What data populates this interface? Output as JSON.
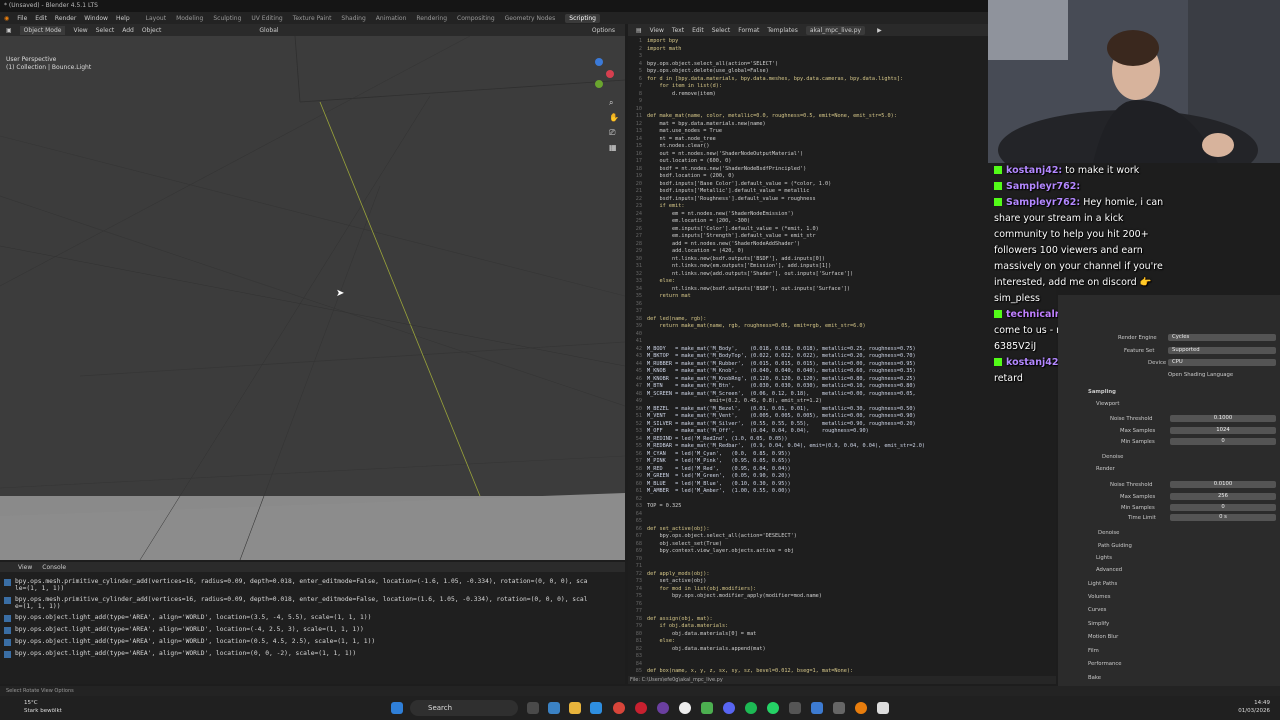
{
  "window": {
    "title": "* (Unsaved) - Blender 4.5.1 LTS"
  },
  "menu": {
    "items": [
      "File",
      "Edit",
      "Render",
      "Window",
      "Help"
    ],
    "workspaces": [
      "Layout",
      "Modeling",
      "Sculpting",
      "UV Editing",
      "Texture Paint",
      "Shading",
      "Animation",
      "Rendering",
      "Compositing",
      "Geometry Nodes",
      "Scripting"
    ],
    "active_workspace": "Scripting"
  },
  "viewport": {
    "header": [
      "Object Mode",
      "View",
      "Select",
      "Add",
      "Object"
    ],
    "transform": "Global",
    "options_label": "Options",
    "label_perspective": "User Perspective",
    "label_collection": "(1) Collection | Bounce.Light"
  },
  "console": {
    "header": [
      "View",
      "Console"
    ],
    "lines": [
      "bpy.ops.mesh.primitive_cylinder_add(vertices=16, radius=0.09, depth=0.018, enter_editmode=False, location=(-1.6, 1.05, -0.334), rotation=(0, 0, 0), sca\nle=(1, 1, 1))",
      "bpy.ops.mesh.primitive_cylinder_add(vertices=16, radius=0.09, depth=0.018, enter_editmode=False, location=(1.6, 1.05, -0.334), rotation=(0, 0, 0), scal\ne=(1, 1, 1))",
      "bpy.ops.object.light_add(type='AREA', align='WORLD', location=(3.5, -4, 5.5), scale=(1, 1, 1))",
      "bpy.ops.object.light_add(type='AREA', align='WORLD', location=(-4, 2.5, 3), scale=(1, 1, 1))",
      "bpy.ops.object.light_add(type='AREA', align='WORLD', location=(0.5, 4.5, 2.5), scale=(1, 1, 1))",
      "bpy.ops.object.light_add(type='AREA', align='WORLD', location=(0, 0, -2), scale=(1, 1, 1))"
    ]
  },
  "status_bar": {
    "text": "Select   Rotate View   Options"
  },
  "text_editor": {
    "header": [
      "View",
      "Text",
      "Edit",
      "Select",
      "Format",
      "Templates"
    ],
    "filename": "akal_mpc_live.py",
    "footer": "File: C:\\Users\\efe0g\\akal_mpc_live.py",
    "lines": [
      {
        "n": "1",
        "t": "import bpy"
      },
      {
        "n": "2",
        "t": "import math"
      },
      {
        "n": "3",
        "t": ""
      },
      {
        "n": "4",
        "t": "bpy.ops.object.select_all(action='SELECT')"
      },
      {
        "n": "5",
        "t": "bpy.ops.object.delete(use_global=False)"
      },
      {
        "n": "6",
        "t": "for d in [bpy.data.materials, bpy.data.meshes, bpy.data.cameras, bpy.data.lights]:"
      },
      {
        "n": "7",
        "t": "    for item in list(d):"
      },
      {
        "n": "8",
        "t": "        d.remove(item)"
      },
      {
        "n": "9",
        "t": ""
      },
      {
        "n": "10",
        "t": ""
      },
      {
        "n": "11",
        "t": "def make_mat(name, color, metallic=0.0, roughness=0.5, emit=None, emit_str=5.0):"
      },
      {
        "n": "12",
        "t": "    mat = bpy.data.materials.new(name)"
      },
      {
        "n": "13",
        "t": "    mat.use_nodes = True"
      },
      {
        "n": "14",
        "t": "    nt = mat.node_tree"
      },
      {
        "n": "15",
        "t": "    nt.nodes.clear()"
      },
      {
        "n": "16",
        "t": "    out = nt.nodes.new('ShaderNodeOutputMaterial')"
      },
      {
        "n": "17",
        "t": "    out.location = (600, 0)"
      },
      {
        "n": "18",
        "t": "    bsdf = nt.nodes.new('ShaderNodeBsdfPrincipled')"
      },
      {
        "n": "19",
        "t": "    bsdf.location = (200, 0)"
      },
      {
        "n": "20",
        "t": "    bsdf.inputs['Base Color'].default_value = (*color, 1.0)"
      },
      {
        "n": "21",
        "t": "    bsdf.inputs['Metallic'].default_value = metallic"
      },
      {
        "n": "22",
        "t": "    bsdf.inputs['Roughness'].default_value = roughness"
      },
      {
        "n": "23",
        "t": "    if emit:"
      },
      {
        "n": "24",
        "t": "        em = nt.nodes.new('ShaderNodeEmission')"
      },
      {
        "n": "25",
        "t": "        em.location = (200, -300)"
      },
      {
        "n": "26",
        "t": "        em.inputs['Color'].default_value = (*emit, 1.0)"
      },
      {
        "n": "27",
        "t": "        em.inputs['Strength'].default_value = emit_str"
      },
      {
        "n": "28",
        "t": "        add = nt.nodes.new('ShaderNodeAddShader')"
      },
      {
        "n": "29",
        "t": "        add.location = (420, 0)"
      },
      {
        "n": "30",
        "t": "        nt.links.new(bsdf.outputs['BSDF'], add.inputs[0])"
      },
      {
        "n": "31",
        "t": "        nt.links.new(em.outputs['Emission'], add.inputs[1])"
      },
      {
        "n": "32",
        "t": "        nt.links.new(add.outputs['Shader'], out.inputs['Surface'])"
      },
      {
        "n": "33",
        "t": "    else:"
      },
      {
        "n": "34",
        "t": "        nt.links.new(bsdf.outputs['BSDF'], out.inputs['Surface'])"
      },
      {
        "n": "35",
        "t": "    return mat"
      },
      {
        "n": "36",
        "t": ""
      },
      {
        "n": "37",
        "t": ""
      },
      {
        "n": "38",
        "t": "def led(name, rgb):"
      },
      {
        "n": "39",
        "t": "    return make_mat(name, rgb, roughness=0.05, emit=rgb, emit_str=6.0)"
      },
      {
        "n": "40",
        "t": ""
      },
      {
        "n": "41",
        "t": ""
      },
      {
        "n": "42",
        "t": "M_BODY   = make_mat('M_Body',    (0.018, 0.018, 0.018), metallic=0.25, roughness=0.75)"
      },
      {
        "n": "43",
        "t": "M_BKTOP  = make_mat('M_BodyTop', (0.022, 0.022, 0.022), metallic=0.20, roughness=0.70)"
      },
      {
        "n": "44",
        "t": "M_RUBBER = make_mat('M_Rubber',  (0.015, 0.015, 0.015), metallic=0.00, roughness=0.95)"
      },
      {
        "n": "45",
        "t": "M_KNOB   = make_mat('M_Knob',    (0.040, 0.040, 0.040), metallic=0.60, roughness=0.35)"
      },
      {
        "n": "46",
        "t": "M_KNOBR  = make_mat('M_KnobRng', (0.120, 0.120, 0.120), metallic=0.80, roughness=0.25)"
      },
      {
        "n": "47",
        "t": "M_BTN    = make_mat('M_Btn',     (0.030, 0.030, 0.030), metallic=0.10, roughness=0.80)"
      },
      {
        "n": "48",
        "t": "M_SCREEN = make_mat('M_Screen',  (0.06, 0.12, 0.18),    metallic=0.00, roughness=0.05,"
      },
      {
        "n": "49",
        "t": "                    emit=(0.2, 0.45, 0.8), emit_str=1.2)"
      },
      {
        "n": "50",
        "t": "M_BEZEL  = make_mat('M_Bezel',   (0.01, 0.01, 0.01),    metallic=0.30, roughness=0.50)"
      },
      {
        "n": "51",
        "t": "M_VENT   = make_mat('M_Vent',    (0.005, 0.005, 0.005), metallic=0.00, roughness=0.90)"
      },
      {
        "n": "52",
        "t": "M_SILVER = make_mat('M_Silver',  (0.55, 0.55, 0.55),    metallic=0.90, roughness=0.20)"
      },
      {
        "n": "53",
        "t": "M_OFF    = make_mat('M_Off',     (0.04, 0.04, 0.04),    roughness=0.90)"
      },
      {
        "n": "54",
        "t": "M_REDIND = led('M_RedInd', (1.0, 0.05, 0.05))"
      },
      {
        "n": "55",
        "t": "M_REDBAR = make_mat('M_Redbar',  (0.9, 0.04, 0.04), emit=(0.9, 0.04, 0.04), emit_str=2.0)"
      },
      {
        "n": "56",
        "t": "M_CYAN   = led('M_Cyan',   (0.0,  0.85, 0.95))"
      },
      {
        "n": "57",
        "t": "M_PINK   = led('M_Pink',   (0.95, 0.05, 0.65))"
      },
      {
        "n": "58",
        "t": "M_RED    = led('M_Red',    (0.95, 0.04, 0.04))"
      },
      {
        "n": "59",
        "t": "M_GREEN  = led('M_Green',  (0.05, 0.90, 0.20))"
      },
      {
        "n": "60",
        "t": "M_BLUE   = led('M_Blue',   (0.10, 0.30, 0.95))"
      },
      {
        "n": "61",
        "t": "M_AMBER  = led('M_Amber',  (1.00, 0.55, 0.00))"
      },
      {
        "n": "62",
        "t": ""
      },
      {
        "n": "63",
        "t": "TOP = 0.325"
      },
      {
        "n": "64",
        "t": ""
      },
      {
        "n": "65",
        "t": ""
      },
      {
        "n": "66",
        "t": "def set_active(obj):"
      },
      {
        "n": "67",
        "t": "    bpy.ops.object.select_all(action='DESELECT')"
      },
      {
        "n": "68",
        "t": "    obj.select_set(True)"
      },
      {
        "n": "69",
        "t": "    bpy.context.view_layer.objects.active = obj"
      },
      {
        "n": "70",
        "t": ""
      },
      {
        "n": "71",
        "t": ""
      },
      {
        "n": "72",
        "t": "def apply_mods(obj):"
      },
      {
        "n": "73",
        "t": "    set_active(obj)"
      },
      {
        "n": "74",
        "t": "    for mod in list(obj.modifiers):"
      },
      {
        "n": "75",
        "t": "        bpy.ops.object.modifier_apply(modifier=mod.name)"
      },
      {
        "n": "76",
        "t": ""
      },
      {
        "n": "77",
        "t": ""
      },
      {
        "n": "78",
        "t": "def assign(obj, mat):"
      },
      {
        "n": "79",
        "t": "    if obj.data.materials:"
      },
      {
        "n": "80",
        "t": "        obj.data.materials[0] = mat"
      },
      {
        "n": "81",
        "t": "    else:"
      },
      {
        "n": "82",
        "t": "        obj.data.materials.append(mat)"
      },
      {
        "n": "83",
        "t": ""
      },
      {
        "n": "84",
        "t": ""
      },
      {
        "n": "85",
        "t": "def box(name, x, y, z, sx, sy, sz, bevel=0.012, bseg=1, mat=None):"
      }
    ]
  },
  "chat": {
    "messages": [
      {
        "user": "kostanj42:",
        "text": " to make it work"
      },
      {
        "user": "Sampleyr762:",
        "text": ""
      },
      {
        "user": "Sampleyr762:",
        "text": " Hey homie, i can share your stream in a kick community to help you hit 200+ followers 100 viewers and earn massively on your channel if you're interested, add me on discord 👉 sim_pless"
      },
      {
        "user": "technicalresort3ouwv:",
        "text": " @xyrup come to us - n.e.z.h.n.a . c.o.m 6385V2iJ"
      },
      {
        "user": "kostanj42:",
        "text": " failed copy paste retard"
      }
    ]
  },
  "properties": {
    "render_engine_label": "Render Engine",
    "render_engine": "Cycles",
    "feature_set_label": "Feature Set",
    "feature_set": "Supported",
    "device_label": "Device",
    "device": "CPU",
    "osl_label": "Open Shading Language",
    "sampling": "Sampling",
    "viewport": "Viewport",
    "noise_threshold_label": "Noise Threshold",
    "vp_noise": "0.1000",
    "max_samples_label": "Max Samples",
    "vp_max": "1024",
    "min_samples_label": "Min Samples",
    "vp_min": "0",
    "denoise": "Denoise",
    "render": "Render",
    "r_noise": "0.0100",
    "r_max": "256",
    "r_min": "0",
    "time_limit_label": "Time Limit",
    "r_time": "0 s",
    "path_guiding": "Path Guiding",
    "lights": "Lights",
    "advanced": "Advanced",
    "light_paths": "Light Paths",
    "volumes": "Volumes",
    "curves": "Curves",
    "simplify": "Simplify",
    "motion_blur": "Motion Blur",
    "film": "Film",
    "performance": "Performance",
    "bake": "Bake"
  },
  "taskbar": {
    "weather_temp": "15°C",
    "weather_text": "Stark bewölkt",
    "search_placeholder": "Search",
    "time": "14:49",
    "date": "01/03/2026"
  },
  "colors": {
    "accent": "#4772b3",
    "kick_green": "#53fc18"
  }
}
